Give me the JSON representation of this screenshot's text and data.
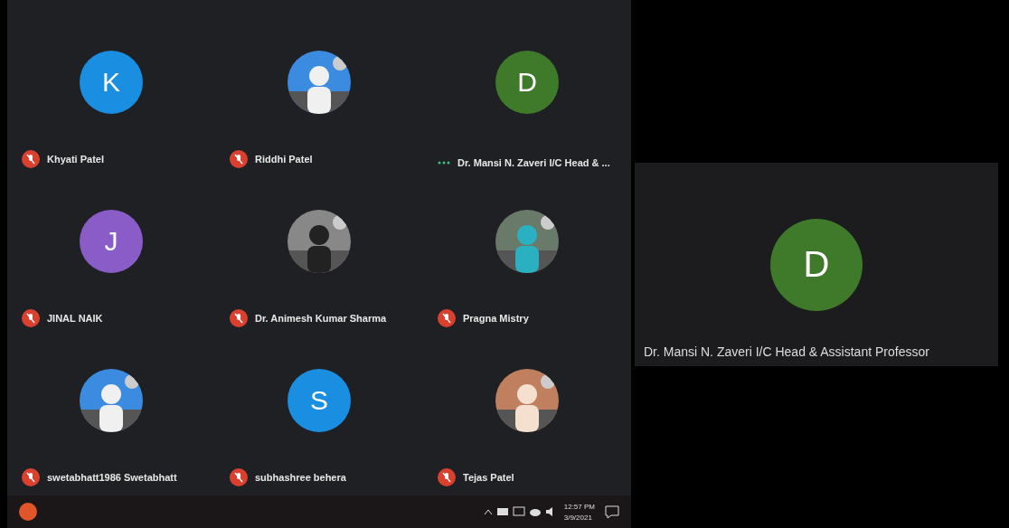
{
  "participants": [
    {
      "name": "Khyati Patel",
      "avatar": {
        "kind": "letter",
        "letter": "K",
        "color": "#1a8ee0"
      },
      "muted": true
    },
    {
      "name": "Riddhi Patel",
      "muted": true
    },
    {
      "name": "Dr. Mansi N. Zaveri I/C Head & ...",
      "avatar": {
        "kind": "letter",
        "letter": "D",
        "color": "#3f7a2a"
      },
      "muted": false
    },
    {
      "name": "JINAL NAIK",
      "avatar": {
        "kind": "letter",
        "letter": "J",
        "color": "#8a5cc8"
      },
      "muted": true
    },
    {
      "name": "Dr. Animesh Kumar Sharma",
      "muted": true
    },
    {
      "name": "Pragna Mistry",
      "muted": true
    },
    {
      "name": "swetabhatt1986 Swetabhatt",
      "muted": true
    },
    {
      "name": "subhashree behera",
      "avatar": {
        "kind": "letter",
        "letter": "S",
        "color": "#1a8ee0"
      },
      "muted": true
    },
    {
      "name": "Tejas Patel",
      "muted": true
    }
  ],
  "spotlight": {
    "name": "Dr. Mansi N. Zaveri I/C Head & Assistant Professor",
    "avatar": {
      "letter": "D",
      "color": "#3f7a2a"
    }
  },
  "taskbar": {
    "time": "12:57 PM",
    "date": "3/9/2021"
  }
}
